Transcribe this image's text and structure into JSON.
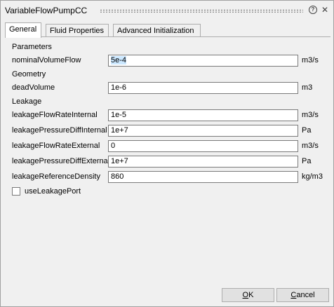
{
  "window": {
    "title": "VariableFlowPumpCC",
    "help_glyph": "?",
    "close_glyph": "✕"
  },
  "tabs": [
    {
      "label": "General",
      "active": true
    },
    {
      "label": "Fluid Properties",
      "active": false
    },
    {
      "label": "Advanced Initialization",
      "active": false
    }
  ],
  "sections": {
    "parameters": "Parameters",
    "geometry": "Geometry",
    "leakage": "Leakage"
  },
  "params": [
    {
      "label": "nominalVolumeFlow",
      "value": "5e-4",
      "unit": "m3/s",
      "selected": true
    },
    {
      "label": "deadVolume",
      "value": "1e-6",
      "unit": "m3"
    },
    {
      "label": "leakageFlowRateInternal",
      "value": "1e-5",
      "unit": "m3/s"
    },
    {
      "label": "leakagePressureDiffInternal",
      "value": "1e+7",
      "unit": "Pa"
    },
    {
      "label": "leakageFlowRateExternal",
      "value": "0",
      "unit": "m3/s"
    },
    {
      "label": "leakagePressureDiffExternal",
      "value": "1e+7",
      "unit": "Pa"
    },
    {
      "label": "leakageReferenceDensity",
      "value": "860",
      "unit": "kg/m3"
    }
  ],
  "checkbox": {
    "label": "useLeakagePort",
    "checked": false
  },
  "buttons": {
    "ok_mnemonic": "O",
    "ok_rest": "K",
    "cancel_mnemonic": "C",
    "cancel_rest": "ancel"
  }
}
